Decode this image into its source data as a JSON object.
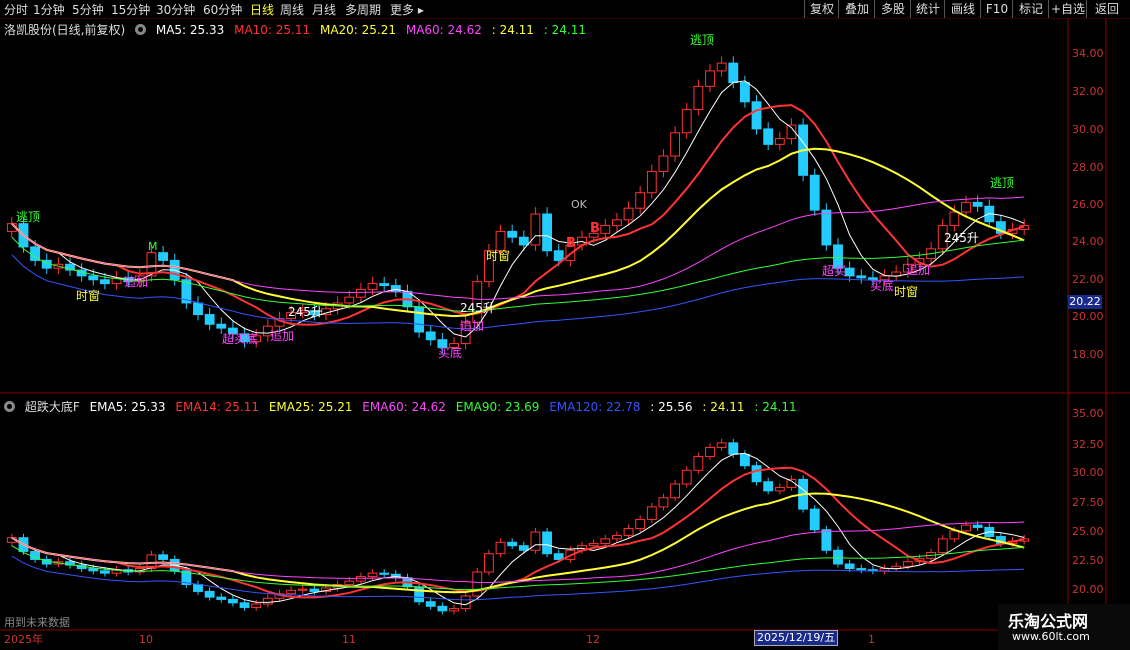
{
  "toolbar": {
    "periods": [
      "分时",
      "1分钟",
      "5分钟",
      "15分钟",
      "30分钟",
      "60分钟",
      "日线",
      "周线",
      "月线",
      "多周期",
      "更多 ▸"
    ],
    "active_period": "日线",
    "buttons": [
      "复权",
      "叠加",
      "多股",
      "统计",
      "画线",
      "F10",
      "标记",
      "+自选",
      "返回"
    ]
  },
  "main_chart": {
    "stock_title": "洛凯股份(日线,前复权)",
    "indicators": [
      {
        "label": "MA5: 25.33",
        "color": "#ffffff"
      },
      {
        "label": "MA10: 25.11",
        "color": "#ff3333"
      },
      {
        "label": "MA20: 25.21",
        "color": "#ffff33"
      },
      {
        "label": "MA60: 24.62",
        "color": "#ff44ff"
      },
      {
        "label": ": 24.11",
        "color": "#ffff33"
      },
      {
        "label": ": 24.11",
        "color": "#33ff33"
      }
    ],
    "y_ticks": [
      "34.00",
      "32.00",
      "30.00",
      "28.00",
      "26.00",
      "24.00",
      "22.00",
      "20.00",
      "18.00"
    ],
    "current_price_tag": "20.22",
    "markers": [
      "逃顶",
      "时窗",
      "追加",
      "超买底",
      "追加",
      "245升",
      "时窗",
      "B",
      "B",
      "OK",
      "追加",
      "买底",
      "逃顶",
      "超买",
      "追加",
      "买底",
      "时窗",
      "245升",
      "逃顶",
      "M",
      "245升"
    ]
  },
  "sub_chart": {
    "title": "超跌大底F",
    "indicators": [
      {
        "label": "EMA5: 25.33",
        "color": "#ffffff"
      },
      {
        "label": "EMA14: 25.11",
        "color": "#ff3333"
      },
      {
        "label": "EMA25: 25.21",
        "color": "#ffff33"
      },
      {
        "label": "EMA60: 24.62",
        "color": "#ff44ff"
      },
      {
        "label": "EMA90: 23.69",
        "color": "#33ff33"
      },
      {
        "label": "EMA120: 22.78",
        "color": "#3355ff"
      },
      {
        "label": ": 25.56",
        "color": "#ffffff"
      },
      {
        "label": ": 24.11",
        "color": "#ffff33"
      },
      {
        "label": ": 24.11",
        "color": "#33ff33"
      }
    ],
    "y_ticks": [
      "35.00",
      "32.50",
      "30.00",
      "27.50",
      "25.00",
      "22.50",
      "20.00"
    ],
    "footnote": "用到未来数据"
  },
  "x_axis": {
    "labels": [
      "2025年",
      "10",
      "11",
      "12",
      "1"
    ],
    "date_tag": "2025/12/19/五"
  },
  "watermark": {
    "title": "乐淘公式网",
    "url": "www.60lt.com"
  },
  "chart_data": {
    "type": "candlestick",
    "series": [
      {
        "name": "MA5",
        "color": "#ffffff"
      },
      {
        "name": "MA10",
        "color": "#ff3333"
      },
      {
        "name": "MA20",
        "color": "#ffff33"
      },
      {
        "name": "MA60",
        "color": "#ff44ff"
      }
    ],
    "closes": [
      25.5,
      24.3,
      23.6,
      23.2,
      23.4,
      23.1,
      22.8,
      22.6,
      22.4,
      22.7,
      22.5,
      22.8,
      24.0,
      23.6,
      22.6,
      21.4,
      20.8,
      20.3,
      20.1,
      19.8,
      19.4,
      19.7,
      20.2,
      20.6,
      20.9,
      21.0,
      20.8,
      21.1,
      21.4,
      21.7,
      22.1,
      22.4,
      22.3,
      22.0,
      21.2,
      19.9,
      19.5,
      19.1,
      19.3,
      20.4,
      22.5,
      24.1,
      25.1,
      24.8,
      24.4,
      26.0,
      24.1,
      23.6,
      24.4,
      24.8,
      25.0,
      25.4,
      25.7,
      26.3,
      27.1,
      28.2,
      29.0,
      30.2,
      31.4,
      32.6,
      33.4,
      33.8,
      32.8,
      31.8,
      30.4,
      29.6,
      29.9,
      30.6,
      28.0,
      26.2,
      24.4,
      23.2,
      22.8,
      22.7,
      22.6,
      22.8,
      23.0,
      23.4,
      23.7,
      24.2,
      25.4,
      26.1,
      26.6,
      26.4,
      25.6,
      25.0,
      25.2,
      25.4
    ],
    "ylim": [
      16.5,
      35.5
    ]
  }
}
